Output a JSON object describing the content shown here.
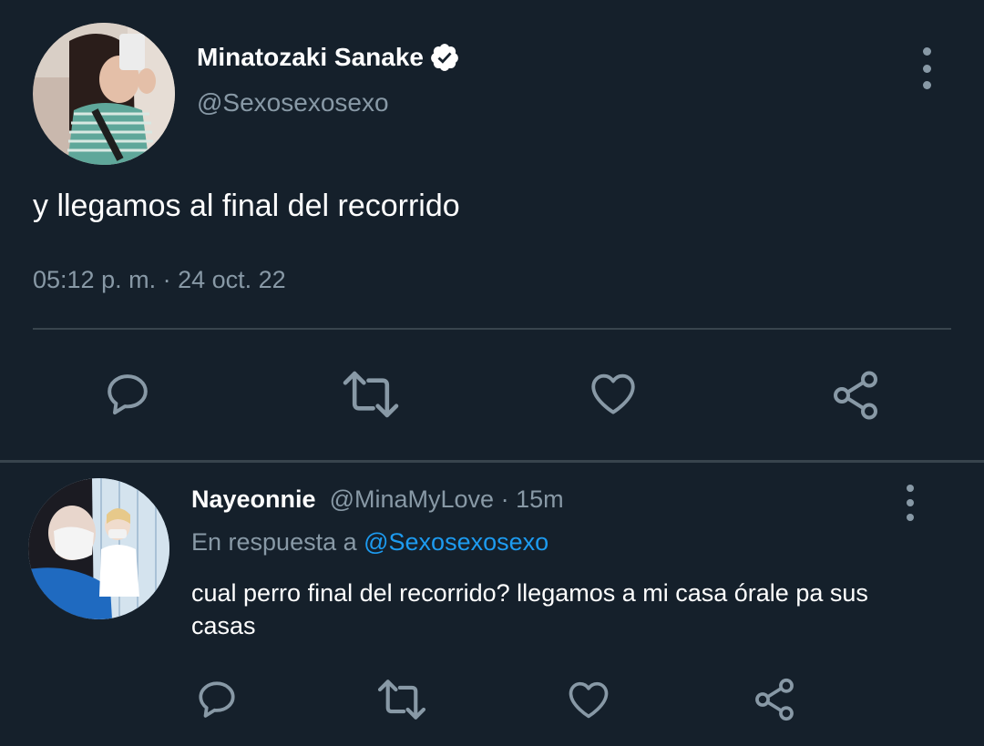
{
  "main_tweet": {
    "author_name": "Minatozaki Sanake",
    "author_handle": "@Sexosexosexo",
    "verified": true,
    "avatar_icon": "avatar-photo",
    "text": "y llegamos al final del recorrido",
    "timestamp": "05:12 p. m. · 24 oct. 22",
    "actions": [
      "reply-icon",
      "retweet-icon",
      "like-icon",
      "share-icon"
    ]
  },
  "reply_tweet": {
    "author_name": "Nayeonnie",
    "author_handle": "@MinaMyLove",
    "separator": " · ",
    "time_ago": "15m",
    "avatar_icon": "avatar-photo",
    "reply_to_label": "En respuesta a ",
    "reply_to_handle": "@Sexosexosexo",
    "text": "cual perro final del recorrido? llegamos a mi casa órale pa sus casas",
    "actions": [
      "reply-icon",
      "retweet-icon",
      "like-icon",
      "share-icon"
    ]
  },
  "colors": {
    "background": "#15202b",
    "primary_text": "#ffffff",
    "secondary_text": "#8899a6",
    "accent": "#1d9bf0",
    "divider": "#38444d"
  }
}
